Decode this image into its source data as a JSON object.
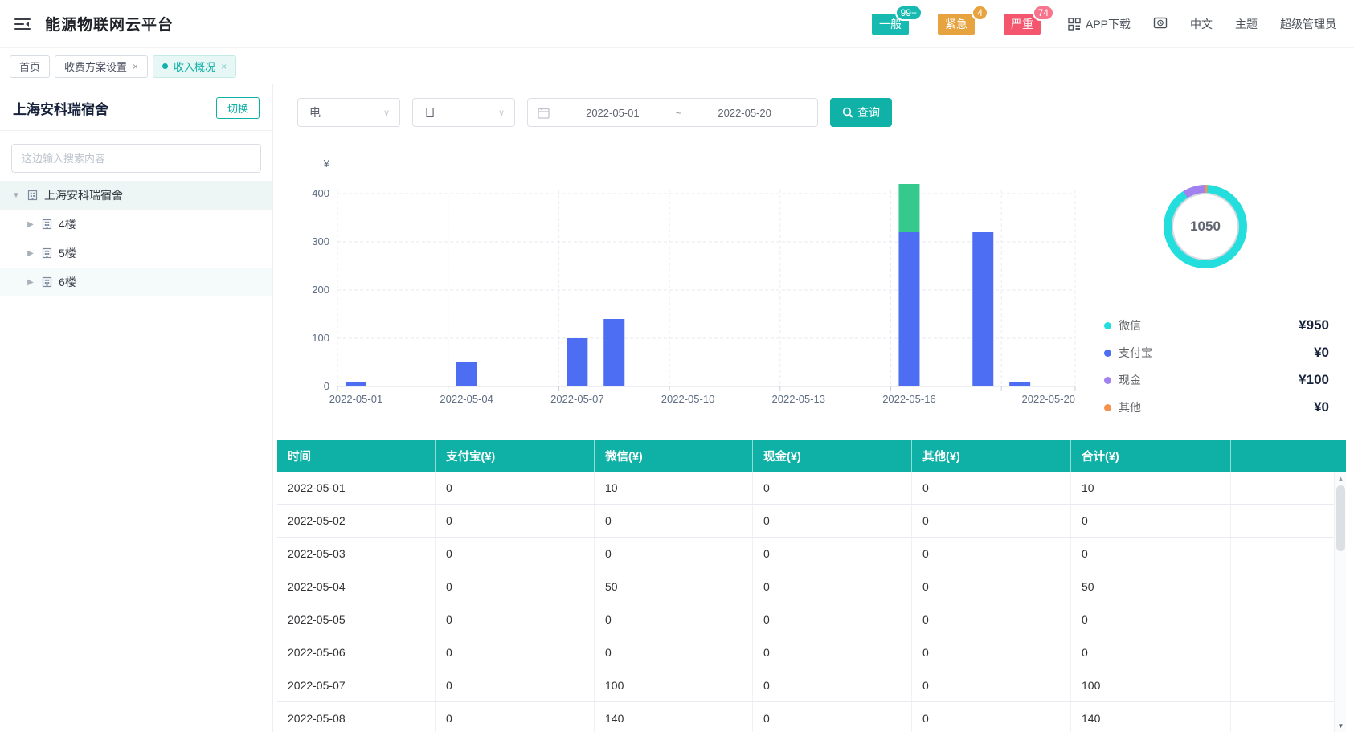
{
  "header": {
    "title": "能源物联网云平台",
    "alarms": [
      {
        "label": "一般",
        "count": "99+",
        "color": "#16bab1"
      },
      {
        "label": "紧急",
        "count": "4",
        "color": "#e7a33f"
      },
      {
        "label": "严重",
        "count": "74",
        "color": "#f4566e",
        "badge_color": "#f6758c"
      }
    ],
    "app_download": "APP下载",
    "language": "中文",
    "theme": "主题",
    "user": "超级管理员"
  },
  "tabs": [
    {
      "label": "首页",
      "closable": false,
      "active": false
    },
    {
      "label": "收费方案设置",
      "closable": true,
      "active": false
    },
    {
      "label": "收入概况",
      "closable": true,
      "active": true
    }
  ],
  "sidebar": {
    "building_title": "上海安科瑞宿舍",
    "switch_button": "切换",
    "search_placeholder": "这边输入搜索内容",
    "tree": [
      {
        "label": "上海安科瑞宿舍",
        "level": 0,
        "expanded": true,
        "selected": true,
        "highlighted": false
      },
      {
        "label": "4楼",
        "level": 1,
        "expanded": false,
        "selected": false,
        "highlighted": false
      },
      {
        "label": "5楼",
        "level": 1,
        "expanded": false,
        "selected": false,
        "highlighted": false
      },
      {
        "label": "6楼",
        "level": 1,
        "expanded": false,
        "selected": false,
        "highlighted": true
      }
    ]
  },
  "filters": {
    "energy_type": "电",
    "period": "日",
    "date_start": "2022-05-01",
    "date_separator": "~",
    "date_end": "2022-05-20",
    "query_button": "查询"
  },
  "chart_data": {
    "type": "bar",
    "stacked": true,
    "title": "",
    "ylabel": "¥",
    "xlabel": "",
    "grid": true,
    "ylim": [
      0,
      440
    ],
    "yticks": [
      0,
      100,
      200,
      300,
      400
    ],
    "x": [
      "2022-05-01",
      "2022-05-02",
      "2022-05-03",
      "2022-05-04",
      "2022-05-05",
      "2022-05-06",
      "2022-05-07",
      "2022-05-08",
      "2022-05-09",
      "2022-05-10",
      "2022-05-11",
      "2022-05-12",
      "2022-05-13",
      "2022-05-14",
      "2022-05-15",
      "2022-05-16",
      "2022-05-17",
      "2022-05-18",
      "2022-05-19",
      "2022-05-20"
    ],
    "x_labels_shown": [
      "2022-05-01",
      "2022-05-04",
      "2022-05-07",
      "2022-05-10",
      "2022-05-13",
      "2022-05-16",
      "2022-05-20"
    ],
    "x_label_indices": [
      0,
      3,
      6,
      9,
      12,
      15,
      19
    ],
    "series": [
      {
        "name": "微信",
        "color": "#4d6df3",
        "values": [
          10,
          0,
          0,
          50,
          0,
          0,
          100,
          140,
          0,
          0,
          0,
          0,
          0,
          0,
          0,
          320,
          0,
          320,
          10,
          0
        ]
      },
      {
        "name": "现金",
        "color": "#35c98e",
        "values": [
          0,
          0,
          0,
          0,
          0,
          0,
          0,
          0,
          0,
          0,
          0,
          0,
          0,
          0,
          0,
          100,
          0,
          0,
          0,
          0
        ]
      }
    ],
    "legend_position": "none"
  },
  "donut": {
    "total": "1050",
    "ring_colors": {
      "wechat": "#23dedd",
      "alipay": "#4d6df3",
      "cash": "#a181f0",
      "other": "#f5924d"
    },
    "legend": [
      {
        "label": "微信",
        "value": "¥950",
        "color": "#23dedd"
      },
      {
        "label": "支付宝",
        "value": "¥0",
        "color": "#4d6df3"
      },
      {
        "label": "现金",
        "value": "¥100",
        "color": "#a181f0"
      },
      {
        "label": "其他",
        "value": "¥0",
        "color": "#f5924d"
      }
    ]
  },
  "table": {
    "headers": [
      "时间",
      "支付宝(¥)",
      "微信(¥)",
      "现金(¥)",
      "其他(¥)",
      "合计(¥)"
    ],
    "rows": [
      [
        "2022-05-01",
        "0",
        "10",
        "0",
        "0",
        "10"
      ],
      [
        "2022-05-02",
        "0",
        "0",
        "0",
        "0",
        "0"
      ],
      [
        "2022-05-03",
        "0",
        "0",
        "0",
        "0",
        "0"
      ],
      [
        "2022-05-04",
        "0",
        "50",
        "0",
        "0",
        "50"
      ],
      [
        "2022-05-05",
        "0",
        "0",
        "0",
        "0",
        "0"
      ],
      [
        "2022-05-06",
        "0",
        "0",
        "0",
        "0",
        "0"
      ],
      [
        "2022-05-07",
        "0",
        "100",
        "0",
        "0",
        "100"
      ],
      [
        "2022-05-08",
        "0",
        "140",
        "0",
        "0",
        "140"
      ]
    ]
  },
  "colors": {
    "primary_teal": "#10b1a7",
    "table_header": "#0fb1a7"
  }
}
